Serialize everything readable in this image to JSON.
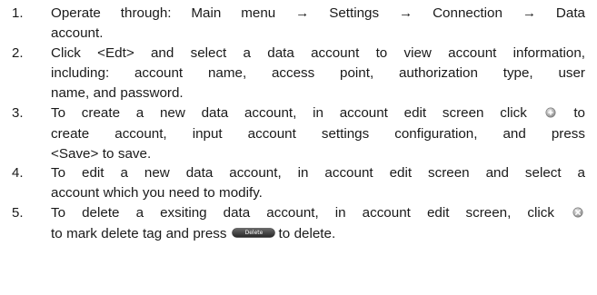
{
  "steps": [
    {
      "number": "1.",
      "lines": [
        "Operate through: Main menu → Settings → Connection → Data",
        "account."
      ]
    },
    {
      "number": "2.",
      "lines": [
        "Click <Edt> and select a data account to view account information,",
        "including: account name, access point, authorization type, user",
        "name, and password."
      ]
    },
    {
      "number": "3.",
      "line1_before_icon": "To create a new data account, in account edit screen click",
      "line1_after_icon": "to",
      "line2": "create account, input account settings configuration, and press",
      "line3": "<Save> to save."
    },
    {
      "number": "4.",
      "lines": [
        "To edit a new data account, in account edit screen and select a",
        "account which you need to modify."
      ]
    },
    {
      "number": "5.",
      "line1": "To delete a exsiting data account, in account edit screen, click",
      "line2_before_button": "to mark delete tag and press",
      "line2_after_button": "to delete."
    }
  ],
  "delete_button_label": "Delete",
  "icons": {
    "add": "add-circle-icon",
    "delete_mark": "delete-mark-icon"
  },
  "colors": {
    "text": "#1a1a1a",
    "button": "#333333"
  }
}
